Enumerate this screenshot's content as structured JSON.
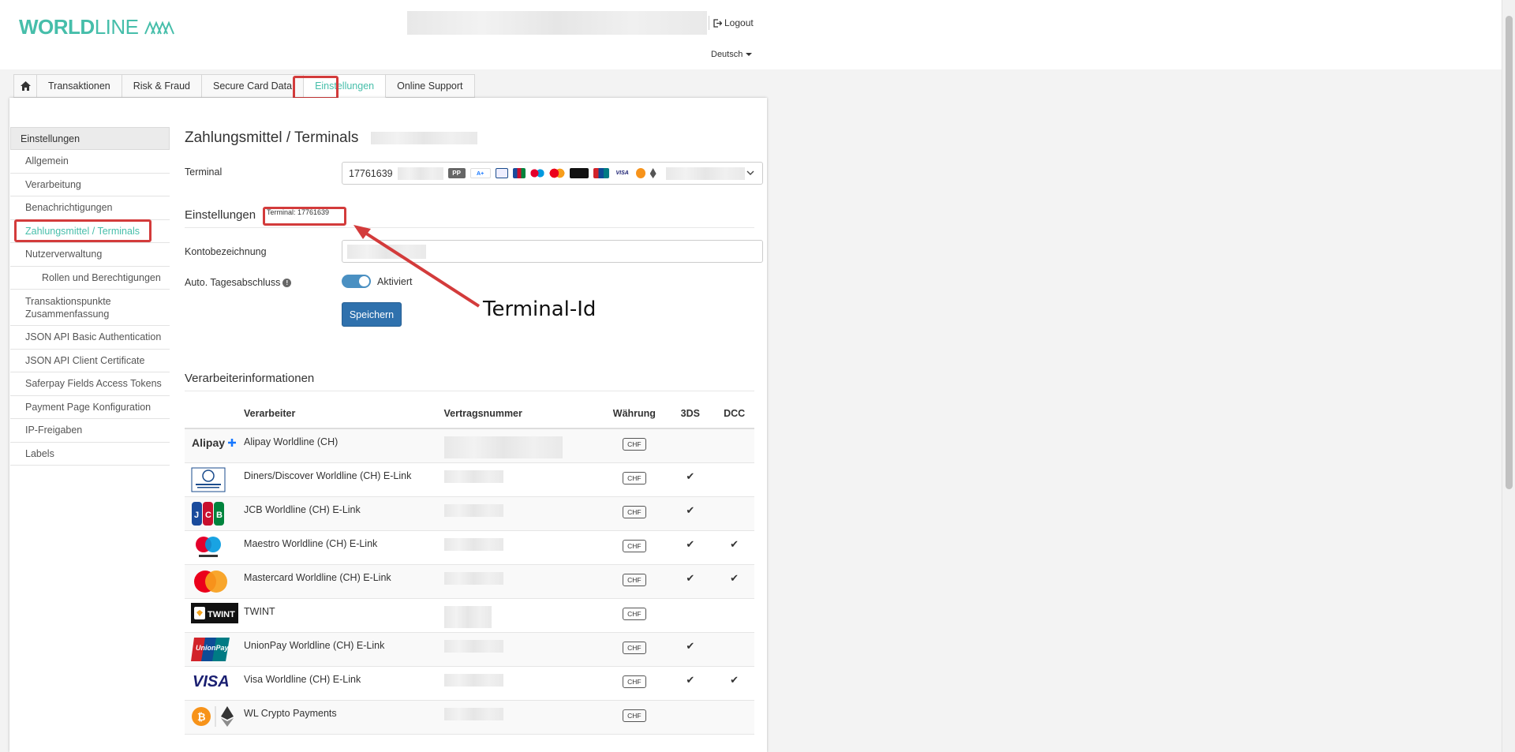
{
  "brand": {
    "logo_world": "WORLD",
    "logo_line": "LINE",
    "accent": "#46beaa"
  },
  "header": {
    "logout": "Logout",
    "language": "Deutsch"
  },
  "tabs": [
    "Transaktionen",
    "Risk & Fraud",
    "Secure Card Data",
    "Einstellungen",
    "Online Support"
  ],
  "sidebar": {
    "head": "Einstellungen",
    "items": [
      {
        "label": "Allgemein"
      },
      {
        "label": "Verarbeitung"
      },
      {
        "label": "Benachrichtigungen"
      },
      {
        "label": "Zahlungsmittel / Terminals"
      },
      {
        "label": "Nutzerverwaltung"
      },
      {
        "label": "Rollen und Berechtigungen"
      },
      {
        "label": "Transaktionspunkte Zusammenfassung"
      },
      {
        "label": "JSON API Basic Authentication"
      },
      {
        "label": "JSON API Client Certificate"
      },
      {
        "label": "Saferpay Fields Access Tokens"
      },
      {
        "label": "Payment Page Konfiguration"
      },
      {
        "label": "IP-Freigaben"
      },
      {
        "label": "Labels"
      }
    ]
  },
  "main": {
    "title": "Zahlungsmittel / Terminals",
    "terminal_label": "Terminal",
    "terminal_value": "17761639",
    "terminal_badge_pp": "PP",
    "settings_title": "Einstellungen",
    "terminal_tag": "Terminal: 17761639",
    "account_label": "Kontobezeichnung",
    "auto_close_label": "Auto. Tagesabschluss",
    "toggle_label": "Aktiviert",
    "save_label": "Speichern",
    "processor_title": "Verarbeiterinformationen",
    "columns": [
      "Verarbeiter",
      "Vertragsnummer",
      "Währung",
      "3DS",
      "DCC"
    ],
    "rows": [
      {
        "logo": "alipay-logo",
        "name": "Alipay Worldline (CH)",
        "currency": "CHF",
        "tds": "",
        "dcc": ""
      },
      {
        "logo": "diners-club-logo",
        "name": "Diners/Discover Worldline (CH) E-Link",
        "currency": "CHF",
        "tds": "✔",
        "dcc": ""
      },
      {
        "logo": "jcb-logo",
        "name": "JCB Worldline (CH) E-Link",
        "currency": "CHF",
        "tds": "✔",
        "dcc": ""
      },
      {
        "logo": "maestro-logo",
        "name": "Maestro Worldline (CH) E-Link",
        "currency": "CHF",
        "tds": "✔",
        "dcc": "✔"
      },
      {
        "logo": "mastercard-logo",
        "name": "Mastercard Worldline (CH) E-Link",
        "currency": "CHF",
        "tds": "✔",
        "dcc": "✔"
      },
      {
        "logo": "twint-logo",
        "name": "TWINT",
        "currency": "CHF",
        "tds": "",
        "dcc": ""
      },
      {
        "logo": "unionpay-logo",
        "name": "UnionPay Worldline (CH) E-Link",
        "currency": "CHF",
        "tds": "✔",
        "dcc": ""
      },
      {
        "logo": "visa-logo",
        "name": "Visa Worldline (CH) E-Link",
        "currency": "CHF",
        "tds": "✔",
        "dcc": "✔"
      },
      {
        "logo": "crypto-logo",
        "name": "WL Crypto Payments",
        "currency": "CHF",
        "tds": "",
        "dcc": ""
      }
    ]
  },
  "annotation": {
    "text": "Terminal-Id",
    "color": "#d33b3b"
  }
}
